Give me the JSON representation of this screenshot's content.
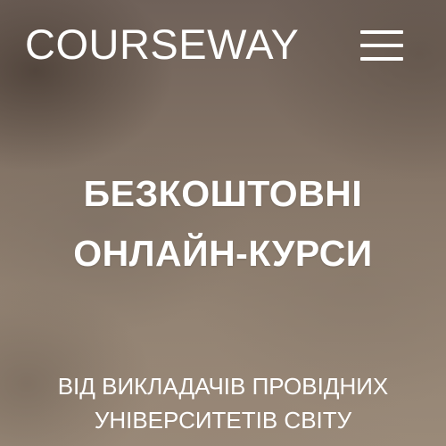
{
  "header": {
    "logo_text": "COURSEWAY",
    "menu_icon": "hamburger-menu-icon"
  },
  "hero": {
    "title_lines": [
      "БЕЗКОШТОВНІ",
      "ОНЛАЙН-КУРСИ"
    ],
    "subtitle_lines": [
      "ВІД ВИКЛАДАЧІВ ПРОВІДНИХ",
      "УНІВЕРСИТЕТІВ СВІТУ"
    ]
  },
  "colors": {
    "text": "#ffffff",
    "background": "#8a7a6c"
  }
}
